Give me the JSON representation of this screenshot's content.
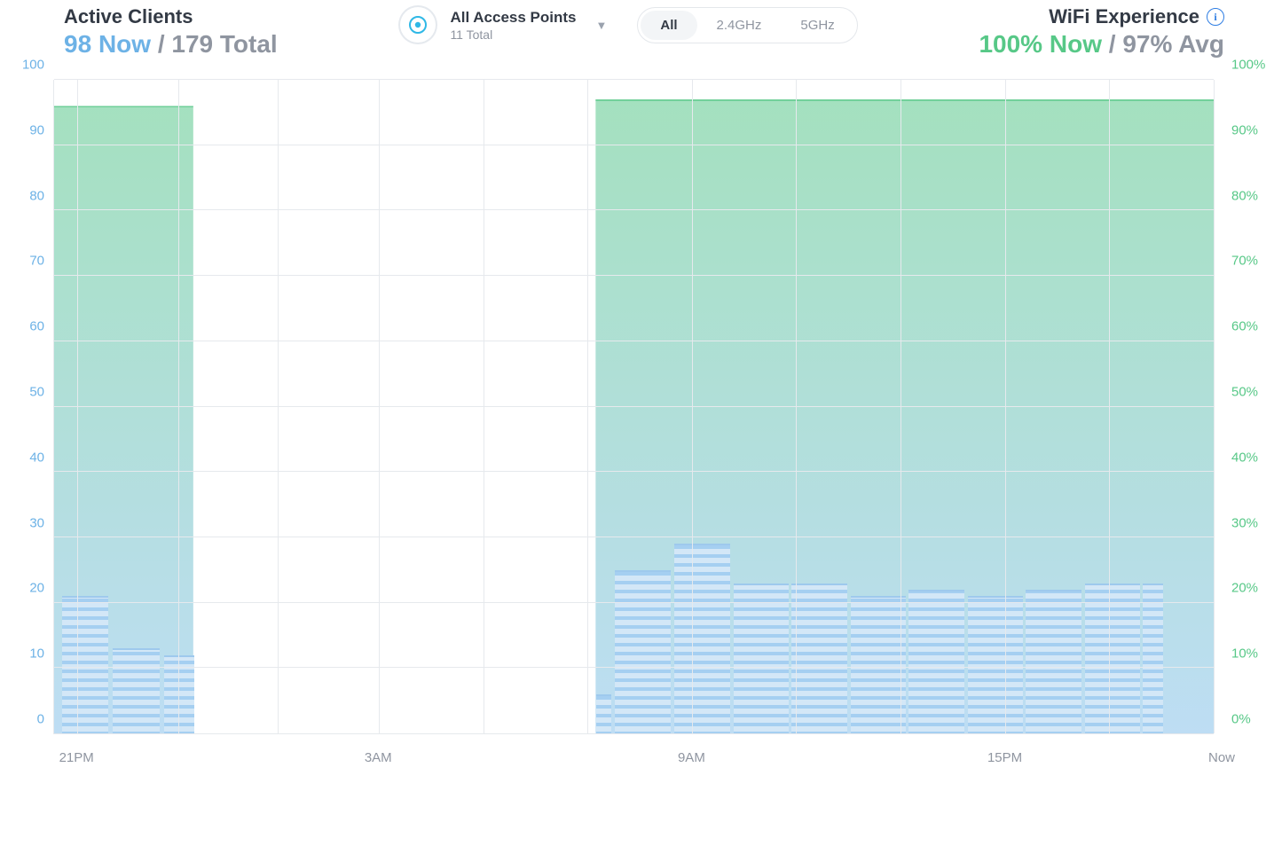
{
  "header": {
    "active_clients": {
      "title": "Active Clients",
      "now_value": "98",
      "now_suffix": "Now",
      "sep": "/",
      "total_value": "179",
      "total_suffix": "Total"
    },
    "access_points": {
      "label": "All Access Points",
      "count": "11 Total",
      "icon": "unifi-ap-icon"
    },
    "tabs": {
      "all": "All",
      "g24": "2.4GHz",
      "g5": "5GHz",
      "active": "all"
    },
    "wifi_experience": {
      "title": "WiFi Experience",
      "now_value": "100%",
      "now_suffix": "Now",
      "sep": "/",
      "avg_value": "97%",
      "avg_suffix": "Avg"
    }
  },
  "left_axis": {
    "ticks": [
      0,
      10,
      20,
      30,
      40,
      50,
      60,
      70,
      80,
      90,
      100
    ],
    "max": 100
  },
  "right_axis": {
    "ticks": [
      "0%",
      "10%",
      "20%",
      "30%",
      "40%",
      "50%",
      "60%",
      "70%",
      "80%",
      "90%",
      "100%"
    ]
  },
  "x_axis": {
    "tick_labels": [
      "21PM",
      "3AM",
      "9AM",
      "15PM"
    ],
    "tick_positions_pct": [
      2.0,
      28.0,
      55.0,
      82.0
    ],
    "now_label": "Now",
    "grid_positions_pct": [
      2.0,
      10.7,
      19.3,
      28.0,
      37.0,
      46.0,
      55.0,
      64.0,
      73.0,
      82.0,
      91.0,
      100.0
    ]
  },
  "chart_data": {
    "type": "bar+area",
    "title": "Active Clients vs WiFi Experience",
    "y_left_label": "Active Clients",
    "y_left_range": [
      0,
      100
    ],
    "y_right_label": "WiFi Experience",
    "y_right_range": [
      0,
      100
    ],
    "x_range_hours": [
      "21:00 (prev day)",
      "Now (~21:00)"
    ],
    "series": [
      {
        "name": "WiFi Experience (%)",
        "axis": "right",
        "style": "area",
        "segments": [
          {
            "x_start_pct": 0,
            "x_end_pct": 12.0,
            "value": 96
          },
          {
            "x_start_pct": 12.0,
            "x_end_pct": 46.7,
            "value": null
          },
          {
            "x_start_pct": 46.7,
            "x_end_pct": 100.0,
            "value": 97
          }
        ]
      },
      {
        "name": "Active Clients (count, hourly)",
        "axis": "left",
        "style": "bar",
        "points": [
          {
            "x_pct": 0.6,
            "w_pct": 4.0,
            "value": 21
          },
          {
            "x_pct": 5.0,
            "w_pct": 4.0,
            "value": 13
          },
          {
            "x_pct": 9.4,
            "w_pct": 2.6,
            "value": 12
          },
          {
            "x_pct": 46.7,
            "w_pct": 1.3,
            "value": 6
          },
          {
            "x_pct": 48.3,
            "w_pct": 4.8,
            "value": 25
          },
          {
            "x_pct": 53.4,
            "w_pct": 4.8,
            "value": 29
          },
          {
            "x_pct": 58.5,
            "w_pct": 4.8,
            "value": 23
          },
          {
            "x_pct": 63.5,
            "w_pct": 4.8,
            "value": 23
          },
          {
            "x_pct": 68.6,
            "w_pct": 4.8,
            "value": 21
          },
          {
            "x_pct": 73.6,
            "w_pct": 4.8,
            "value": 22
          },
          {
            "x_pct": 78.7,
            "w_pct": 4.8,
            "value": 21
          },
          {
            "x_pct": 83.7,
            "w_pct": 4.8,
            "value": 22
          },
          {
            "x_pct": 88.8,
            "w_pct": 4.8,
            "value": 23
          },
          {
            "x_pct": 93.8,
            "w_pct": 1.8,
            "value": 23
          }
        ]
      }
    ]
  }
}
